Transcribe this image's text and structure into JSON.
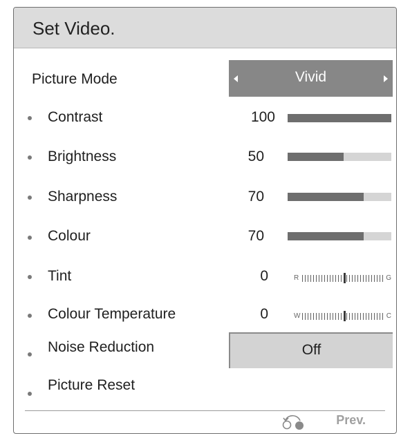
{
  "header": {
    "title": "Set Video."
  },
  "picture_mode": {
    "label": "Picture Mode",
    "value": "Vivid"
  },
  "settings": [
    {
      "label": "Contrast",
      "value": "100",
      "level_percent": 100
    },
    {
      "label": "Brightness",
      "value": "50",
      "level_percent": 54
    },
    {
      "label": "Sharpness",
      "value": "70",
      "level_percent": 73
    },
    {
      "label": "Colour",
      "value": "70",
      "level_percent": 73
    }
  ],
  "tint": {
    "label": "Tint",
    "value": "0",
    "left_end": "R",
    "right_end": "G"
  },
  "colour_temperature": {
    "label": "Colour Temperature",
    "value": "0",
    "left_end": "W",
    "right_end": "C"
  },
  "noise_reduction": {
    "label": "Noise Reduction",
    "value": "Off"
  },
  "picture_reset": {
    "label": "Picture Reset"
  },
  "footer": {
    "prev_label": "Prev.",
    "icon": "return-icon"
  }
}
